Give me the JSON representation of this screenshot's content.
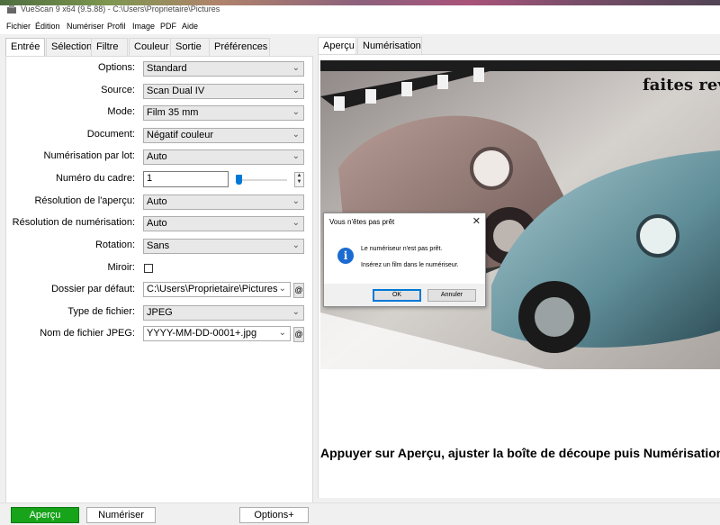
{
  "window": {
    "title": "VueScan 9 x64 (9.5.88) - C:\\Users\\Proprietaire\\Pictures"
  },
  "menu": [
    "Fichier",
    "Édition",
    "Numériser",
    "Profil",
    "Image",
    "PDF",
    "Aide"
  ],
  "left_tabs": [
    "Entrée",
    "Sélection",
    "Filtre",
    "Couleur",
    "Sortie",
    "Préférences"
  ],
  "right_tabs": [
    "Aperçu",
    "Numérisation"
  ],
  "form": {
    "options": {
      "label": "Options:",
      "value": "Standard"
    },
    "source": {
      "label": "Source:",
      "value": "Scan Dual IV"
    },
    "mode": {
      "label": "Mode:",
      "value": "Film 35 mm"
    },
    "document": {
      "label": "Document:",
      "value": "Négatif couleur"
    },
    "batch": {
      "label": "Numérisation par lot:",
      "value": "Auto"
    },
    "frame": {
      "label": "Numéro du cadre:",
      "value": "1"
    },
    "preview_res": {
      "label": "Résolution de l'aperçu:",
      "value": "Auto"
    },
    "scan_res": {
      "label": "Résolution de numérisation:",
      "value": "Auto"
    },
    "rotation": {
      "label": "Rotation:",
      "value": "Sans"
    },
    "mirror": {
      "label": "Miroir:"
    },
    "folder": {
      "label": "Dossier par défaut:",
      "value": "C:\\Users\\Proprietaire\\Pictures"
    },
    "filetype": {
      "label": "Type de fichier:",
      "value": "JPEG"
    },
    "jpeg_name": {
      "label": "Nom de fichier JPEG:",
      "value": "YYYY-MM-DD-0001+.jpg"
    },
    "at_symbol": "@"
  },
  "preview": {
    "overlay_text": "faites rev",
    "caption": "Appuyer sur Aperçu, ajuster la boîte de découpe puis Numérisation"
  },
  "dialog": {
    "title": "Vous n'êtes pas prêt",
    "close": "✕",
    "icon": "i",
    "message1": "Le numériseur n'est pas prêt.",
    "message2": "Insérez un film dans le numériseur.",
    "ok": "OK",
    "cancel": "Annuler"
  },
  "bottom": {
    "preview_btn": "Aperçu",
    "scan_btn": "Numériser",
    "options_btn": "Options+"
  },
  "colors": {
    "accent": "#0078d7",
    "green_button": "#17a31a"
  }
}
